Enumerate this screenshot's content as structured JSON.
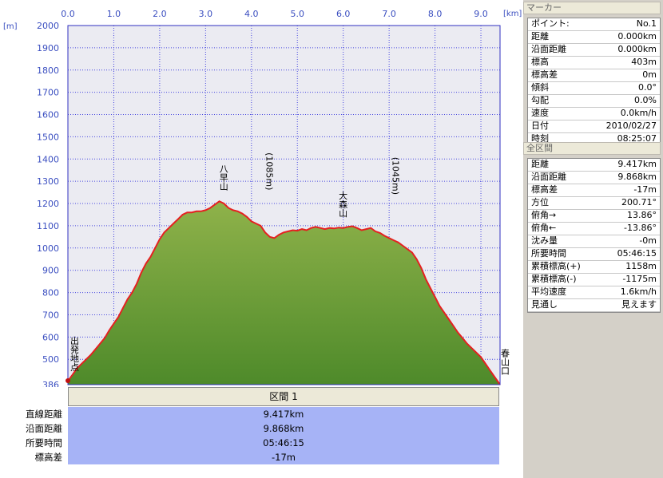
{
  "chart_data": {
    "type": "area",
    "xlabel_unit": "[km]",
    "ylabel_unit": "[m]",
    "x_ticks": [
      "0.0",
      "1.0",
      "2.0",
      "3.0",
      "4.0",
      "5.0",
      "6.0",
      "7.0",
      "8.0",
      "9.0"
    ],
    "y_ticks": [
      "2000",
      "1900",
      "1800",
      "1700",
      "1600",
      "1500",
      "1400",
      "1300",
      "1200",
      "1100",
      "1000",
      "900",
      "800",
      "700",
      "600",
      "500",
      "386"
    ],
    "xlim": [
      0,
      9.417
    ],
    "ylim": [
      386,
      2000
    ],
    "grid": true,
    "colors": {
      "line": "#e52020",
      "fill_top": "#8fb24a",
      "fill_bottom": "#4e8a2a",
      "plot_bg": "#ebebf2",
      "grid": "#4848e0"
    },
    "x": [
      0.0,
      0.1,
      0.2,
      0.3,
      0.4,
      0.5,
      0.6,
      0.7,
      0.8,
      0.9,
      1.0,
      1.1,
      1.2,
      1.3,
      1.4,
      1.5,
      1.6,
      1.7,
      1.8,
      1.9,
      2.0,
      2.1,
      2.2,
      2.3,
      2.4,
      2.5,
      2.6,
      2.7,
      2.8,
      2.9,
      3.0,
      3.1,
      3.2,
      3.3,
      3.4,
      3.5,
      3.6,
      3.7,
      3.8,
      3.9,
      4.0,
      4.1,
      4.2,
      4.3,
      4.4,
      4.5,
      4.6,
      4.7,
      4.8,
      4.9,
      5.0,
      5.1,
      5.2,
      5.3,
      5.4,
      5.5,
      5.6,
      5.7,
      5.8,
      5.9,
      6.0,
      6.1,
      6.2,
      6.3,
      6.4,
      6.5,
      6.6,
      6.7,
      6.8,
      6.9,
      7.0,
      7.1,
      7.2,
      7.3,
      7.4,
      7.5,
      7.6,
      7.7,
      7.8,
      7.9,
      8.0,
      8.1,
      8.2,
      8.3,
      8.4,
      8.5,
      8.6,
      8.7,
      8.8,
      8.9,
      9.0,
      9.1,
      9.2,
      9.3,
      9.417
    ],
    "y": [
      403,
      430,
      460,
      480,
      500,
      520,
      545,
      570,
      595,
      630,
      660,
      690,
      730,
      770,
      800,
      840,
      890,
      930,
      960,
      1000,
      1040,
      1070,
      1090,
      1110,
      1130,
      1150,
      1160,
      1160,
      1165,
      1165,
      1170,
      1180,
      1195,
      1210,
      1200,
      1180,
      1170,
      1165,
      1155,
      1140,
      1120,
      1110,
      1100,
      1070,
      1050,
      1045,
      1060,
      1070,
      1075,
      1080,
      1078,
      1085,
      1080,
      1090,
      1095,
      1090,
      1085,
      1090,
      1088,
      1092,
      1090,
      1095,
      1098,
      1090,
      1080,
      1085,
      1090,
      1075,
      1068,
      1055,
      1045,
      1035,
      1025,
      1010,
      995,
      980,
      950,
      910,
      860,
      820,
      780,
      740,
      710,
      680,
      650,
      620,
      595,
      570,
      550,
      530,
      510,
      480,
      450,
      420,
      386
    ],
    "annotations": [
      {
        "text": "出発地点",
        "x": 0.0,
        "y": 403
      },
      {
        "text": "八早山",
        "x": 3.25,
        "y": 1215
      },
      {
        "text": "(1085m)",
        "x": 4.25,
        "y": 1110
      },
      {
        "text": "大森山",
        "x": 5.85,
        "y": 1095
      },
      {
        "text": "(1045m)",
        "x": 7.0,
        "y": 1090
      },
      {
        "text": "春山口",
        "x": 9.417,
        "y": 386
      }
    ]
  },
  "section": {
    "header": "区間 1",
    "rows": [
      {
        "label": "直線距離",
        "value": "9.417km"
      },
      {
        "label": "沿面距離",
        "value": "9.868km"
      },
      {
        "label": "所要時間",
        "value": "05:46:15"
      },
      {
        "label": "標高差",
        "value": "-17m"
      }
    ]
  },
  "marker_panel": {
    "title": "マーカー",
    "rows": [
      {
        "key": "ポイント:",
        "value": "No.1"
      },
      {
        "key": "距離",
        "value": "0.000km"
      },
      {
        "key": "沿面距離",
        "value": "0.000km"
      },
      {
        "key": "標高",
        "value": "403m"
      },
      {
        "key": "標高差",
        "value": "0m"
      },
      {
        "key": "傾斜",
        "value": "0.0°"
      },
      {
        "key": "勾配",
        "value": "0.0%"
      },
      {
        "key": "速度",
        "value": "0.0km/h"
      },
      {
        "key": "日付",
        "value": "2010/02/27"
      },
      {
        "key": "時刻",
        "value": "08:25:07"
      }
    ]
  },
  "total_panel": {
    "title": "全区間",
    "rows": [
      {
        "key": "距離",
        "value": "9.417km"
      },
      {
        "key": "沿面距離",
        "value": "9.868km"
      },
      {
        "key": "標高差",
        "value": "-17m"
      },
      {
        "key": "方位",
        "value": "200.71°"
      },
      {
        "key": "俯角→",
        "value": "13.86°"
      },
      {
        "key": "俯角←",
        "value": "-13.86°"
      },
      {
        "key": "沈み量",
        "value": "-0m"
      },
      {
        "key": "所要時間",
        "value": "05:46:15"
      },
      {
        "key": "累積標高(+)",
        "value": "1158m"
      },
      {
        "key": "累積標高(-)",
        "value": "-1175m"
      },
      {
        "key": "平均速度",
        "value": "1.6km/h"
      },
      {
        "key": "見通し",
        "value": "見えます"
      }
    ]
  }
}
